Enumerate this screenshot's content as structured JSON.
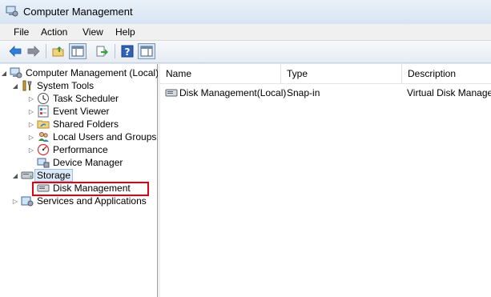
{
  "window": {
    "title": "Computer Management"
  },
  "menu": [
    "File",
    "Action",
    "View",
    "Help"
  ],
  "toolbar": {
    "buttons": [
      "back-arrow-icon",
      "forward-arrow-icon",
      "up-folder-icon",
      "show-hide-console-tree-icon",
      "export-list-icon",
      "help-icon",
      "show-hide-action-pane-icon"
    ]
  },
  "tree": {
    "root": "Computer Management (Local)",
    "system_tools": "System Tools",
    "task_scheduler": "Task Scheduler",
    "event_viewer": "Event Viewer",
    "shared_folders": "Shared Folders",
    "local_users": "Local Users and Groups",
    "performance": "Performance",
    "device_manager": "Device Manager",
    "storage": "Storage",
    "disk_management": "Disk Management",
    "services": "Services and Applications"
  },
  "list": {
    "columns": [
      "Name",
      "Type",
      "Description"
    ],
    "rows": [
      {
        "name": "Disk Management(Local)",
        "type": "Snap-in",
        "description": "Virtual Disk Manage"
      }
    ]
  },
  "colors": {
    "highlight": "#e0000f",
    "selected": "#dceaf9"
  }
}
